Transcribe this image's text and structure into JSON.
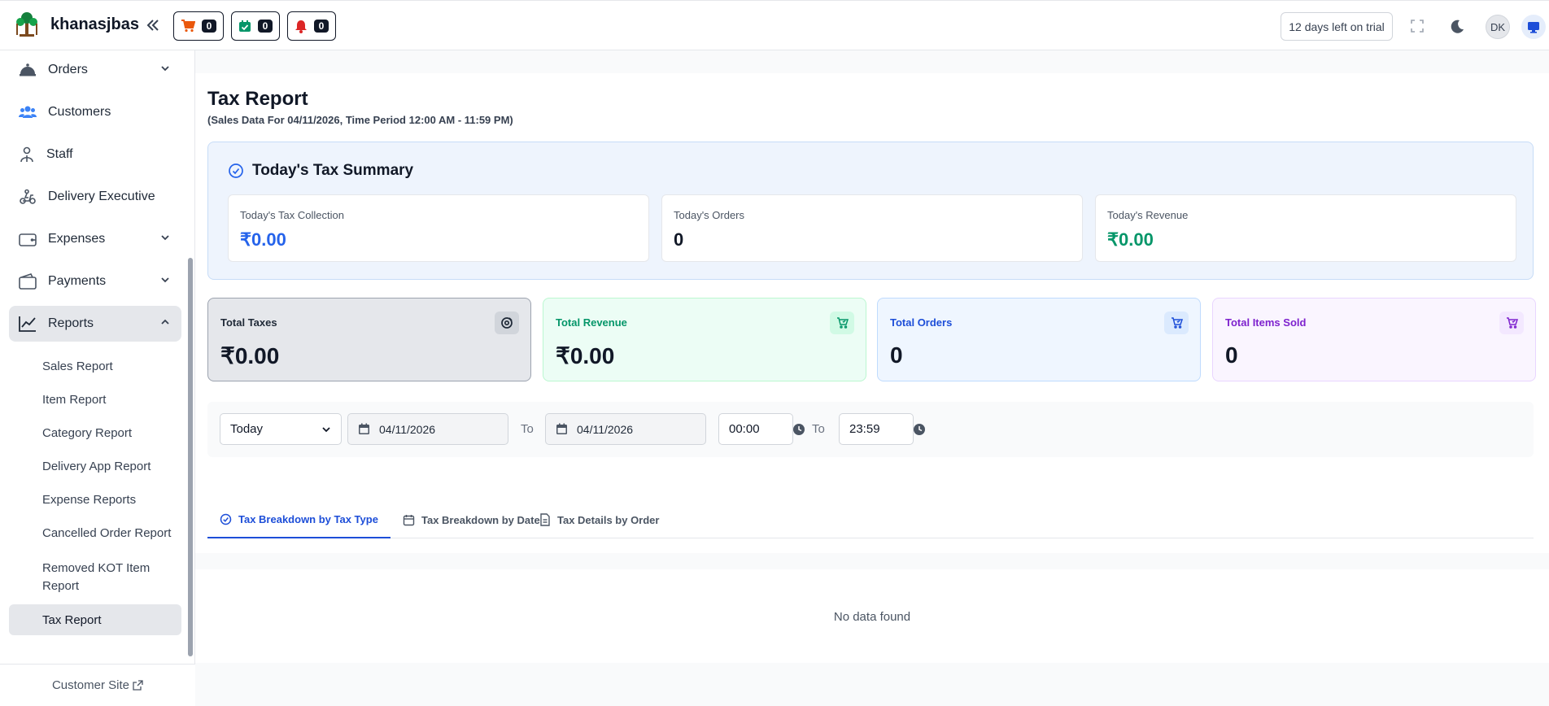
{
  "brand": {
    "name": "khanasjbas",
    "logo_icon": "tree-logo-icon"
  },
  "topbar": {
    "cart_count": "0",
    "orders_count": "0",
    "alerts_count": "0",
    "trial_label": "12 days left on trial",
    "avatar_initials": "DK"
  },
  "sidebar": {
    "items": [
      {
        "label": "Orders",
        "icon": "cloche-icon"
      },
      {
        "label": "Customers",
        "icon": "users-icon"
      },
      {
        "label": "Staff",
        "icon": "staff-icon"
      },
      {
        "label": "Delivery Executive",
        "icon": "scooter-icon"
      },
      {
        "label": "Expenses",
        "icon": "wallet-icon"
      },
      {
        "label": "Payments",
        "icon": "wallet2-icon"
      },
      {
        "label": "Reports",
        "icon": "chart-icon"
      }
    ],
    "reports_sub": [
      "Sales Report",
      "Item Report",
      "Category Report",
      "Delivery App Report",
      "Expense Reports",
      "Cancelled Order Report",
      "Removed KOT Item",
      "Report",
      "Tax Report"
    ],
    "footer_link": "Customer Site"
  },
  "page": {
    "title": "Tax Report",
    "subtitle": "(Sales Data For 04/11/2026, Time Period 12:00 AM - 11:59 PM)"
  },
  "summary": {
    "title": "Today's Tax Summary",
    "cards": [
      {
        "label": "Today's Tax Collection",
        "value": "₹0.00",
        "color": "#2563eb"
      },
      {
        "label": "Today's Orders",
        "value": "0",
        "color": "#111827"
      },
      {
        "label": "Today's Revenue",
        "value": "₹0.00",
        "color": "#059669"
      }
    ]
  },
  "stats": [
    {
      "label": "Total Taxes",
      "value": "₹0.00",
      "color": "#1f2937",
      "bg": "#e5e7eb",
      "border": "#9ca3af"
    },
    {
      "label": "Total Revenue",
      "value": "₹0.00",
      "color": "#059669",
      "bg": "#ecfdf5",
      "border": "#bbf7d0"
    },
    {
      "label": "Total Orders",
      "value": "0",
      "color": "#1d4ed8",
      "bg": "#eff6ff",
      "border": "#bfdbfe"
    },
    {
      "label": "Total Items Sold",
      "value": "0",
      "color": "#7e22ce",
      "bg": "#faf5ff",
      "border": "#e9d5ff"
    }
  ],
  "filters": {
    "period": "Today",
    "from_date": "04/11/2026",
    "to_label": "To",
    "to_date": "04/11/2026",
    "from_time": "00:00",
    "to_time": "23:59"
  },
  "tabs": [
    {
      "label": "Tax Breakdown by Tax Type",
      "active": true
    },
    {
      "label": "Tax Breakdown by Date",
      "active": false
    },
    {
      "label": "Tax Details by Order",
      "active": false
    }
  ],
  "empty_message": "No data found"
}
